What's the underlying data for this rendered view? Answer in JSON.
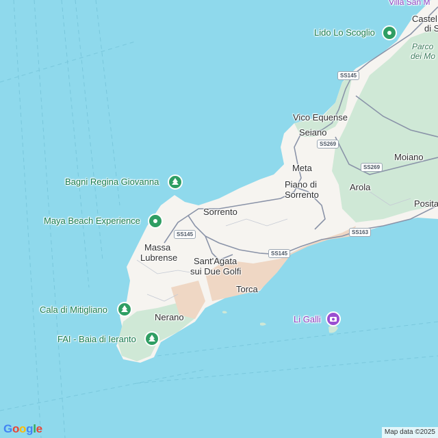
{
  "map": {
    "towns": [
      {
        "name": "Vico Equense"
      },
      {
        "name": "Seiano"
      },
      {
        "name": "Meta"
      },
      {
        "name": "Piano di"
      },
      {
        "name": "Sorrento"
      },
      {
        "name": "Sorrento"
      },
      {
        "name": "Massa"
      },
      {
        "name": "Lubrense"
      },
      {
        "name": "Sant'Agata"
      },
      {
        "name": "sui Due Golfi"
      },
      {
        "name": "Torca"
      },
      {
        "name": "Nerano"
      },
      {
        "name": "Moiano"
      },
      {
        "name": "Arola"
      },
      {
        "name": "Posita"
      },
      {
        "name": "Castel"
      },
      {
        "name": "di S"
      },
      {
        "name": "Villa San M"
      },
      {
        "name": "Parco"
      },
      {
        "name": "dei Mo"
      }
    ],
    "places": [
      {
        "name": "Bagni Regina Giovanna",
        "icon": "tree-icon",
        "color": "#2f9e63"
      },
      {
        "name": "Maya Beach Experience",
        "icon": "beach-icon",
        "color": "#2f9e63"
      },
      {
        "name": "Cala di Mitigliano",
        "icon": "tree-icon",
        "color": "#2f9e63"
      },
      {
        "name": "FAI - Baia di Ieranto",
        "icon": "tree-icon",
        "color": "#2f9e63"
      },
      {
        "name": "Lido Lo Scoglio",
        "icon": "beach-icon",
        "color": "#2f9e63"
      },
      {
        "name": "Li Galli",
        "icon": "camera-icon",
        "color": "#9a4fd1"
      }
    ],
    "roads": [
      "SS145",
      "SS145",
      "SS145",
      "SS269",
      "SS269",
      "SS163"
    ]
  },
  "colors": {
    "water": "#8fd9ec",
    "land": "#f6f4f0",
    "forest": "#cfe8d6",
    "hills": "#efd7c4",
    "road": "#8a93a8"
  },
  "footer": {
    "google_letters": [
      "G",
      "o",
      "o",
      "g",
      "l",
      "e"
    ],
    "attribution": "Map data ©2025"
  }
}
